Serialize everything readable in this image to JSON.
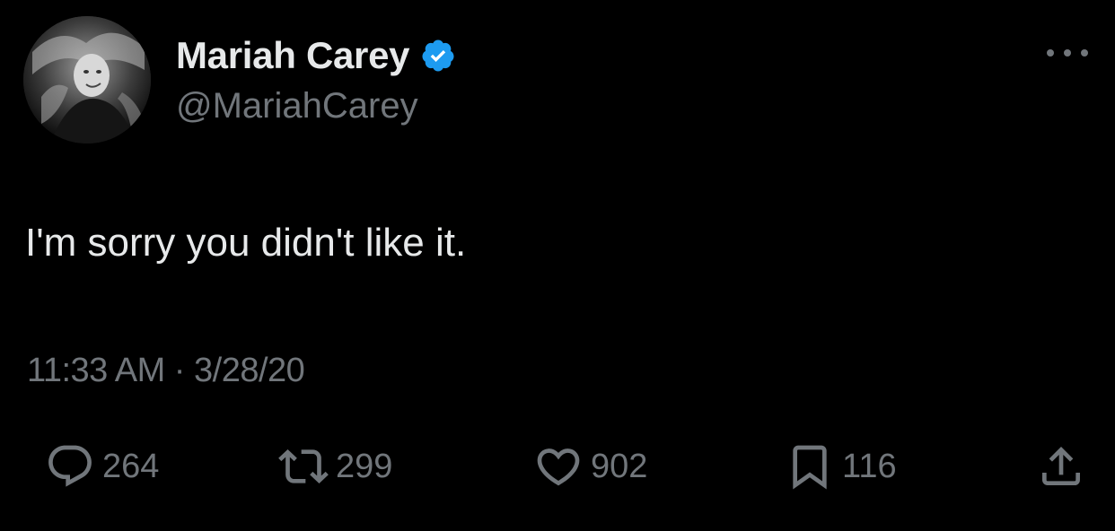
{
  "author": {
    "display_name": "Mariah Carey",
    "handle": "@MariahCarey",
    "verified": true,
    "verified_color": "#1d9bf0"
  },
  "tweet": {
    "text": "I'm sorry you didn't like it.",
    "time": "11:33 AM",
    "separator": "·",
    "date": "3/28/20"
  },
  "actions": {
    "replies": "264",
    "retweets": "299",
    "likes": "902",
    "bookmarks": "116"
  },
  "icons": {
    "more": "more-horizontal-icon",
    "reply": "reply-bubble-icon",
    "retweet": "retweet-arrows-icon",
    "like": "heart-icon",
    "bookmark": "bookmark-icon",
    "share": "share-upload-icon"
  },
  "colors": {
    "background": "#000000",
    "primary_text": "#e7e9ea",
    "secondary_text": "#71767b"
  }
}
